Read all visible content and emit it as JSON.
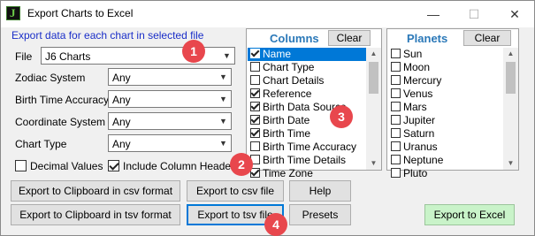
{
  "window": {
    "title": "Export Charts to Excel",
    "minimize_glyph": "—",
    "maximize_glyph": "☐",
    "close_glyph": "✕"
  },
  "intro_text": "Export data for each chart in selected file",
  "form": {
    "file_label": "File",
    "file_value": "J6 Charts",
    "zodiac_label": "Zodiac System",
    "zodiac_value": "Any",
    "birth_time_accuracy_label": "Birth Time Accuracy",
    "birth_time_accuracy_value": "Any",
    "coordinate_label": "Coordinate System",
    "coordinate_value": "Any",
    "chart_type_label": "Chart Type",
    "chart_type_value": "Any"
  },
  "options": {
    "decimal_values_label": "Decimal Values",
    "decimal_values_checked": false,
    "include_headers_label": "Include Column Headers",
    "include_headers_checked": true
  },
  "columns_panel": {
    "title": "Columns",
    "clear_label": "Clear",
    "items": [
      {
        "label": "Name",
        "checked": true,
        "selected": true
      },
      {
        "label": "Chart Type",
        "checked": false
      },
      {
        "label": "Chart Details",
        "checked": false
      },
      {
        "label": "Reference",
        "checked": true
      },
      {
        "label": "Birth Data Source",
        "checked": true
      },
      {
        "label": "Birth Date",
        "checked": true
      },
      {
        "label": "Birth Time",
        "checked": true
      },
      {
        "label": "Birth Time Accuracy",
        "checked": false
      },
      {
        "label": "Birth Time Details",
        "checked": false
      },
      {
        "label": "Time Zone",
        "checked": true
      }
    ]
  },
  "planets_panel": {
    "title": "Planets",
    "clear_label": "Clear",
    "items": [
      {
        "label": "Sun",
        "checked": false
      },
      {
        "label": "Moon",
        "checked": false
      },
      {
        "label": "Mercury",
        "checked": false
      },
      {
        "label": "Venus",
        "checked": false
      },
      {
        "label": "Mars",
        "checked": false
      },
      {
        "label": "Jupiter",
        "checked": false
      },
      {
        "label": "Saturn",
        "checked": false
      },
      {
        "label": "Uranus",
        "checked": false
      },
      {
        "label": "Neptune",
        "checked": false
      },
      {
        "label": "Pluto",
        "checked": false
      }
    ]
  },
  "buttons": {
    "clip_csv": "Export to Clipboard in csv format",
    "csv_file": "Export to csv file",
    "help": "Help",
    "clip_tsv": "Export to Clipboard in tsv format",
    "tsv_file": "Export to tsv file",
    "presets": "Presets",
    "export_excel": "Export to Excel"
  },
  "callouts": [
    "1",
    "2",
    "3",
    "4"
  ],
  "colors": {
    "intro_text": "#1a2ec8",
    "callout": "#e8474d",
    "panel_title": "#2a78b8",
    "selection": "#0078d7",
    "excel_button": "#c9f3c9"
  },
  "icons": {
    "app": "j-app-icon",
    "dropdown": "chevron-down-icon",
    "scroll_up": "scroll-up-arrow-icon",
    "scroll_down": "scroll-down-arrow-icon"
  }
}
